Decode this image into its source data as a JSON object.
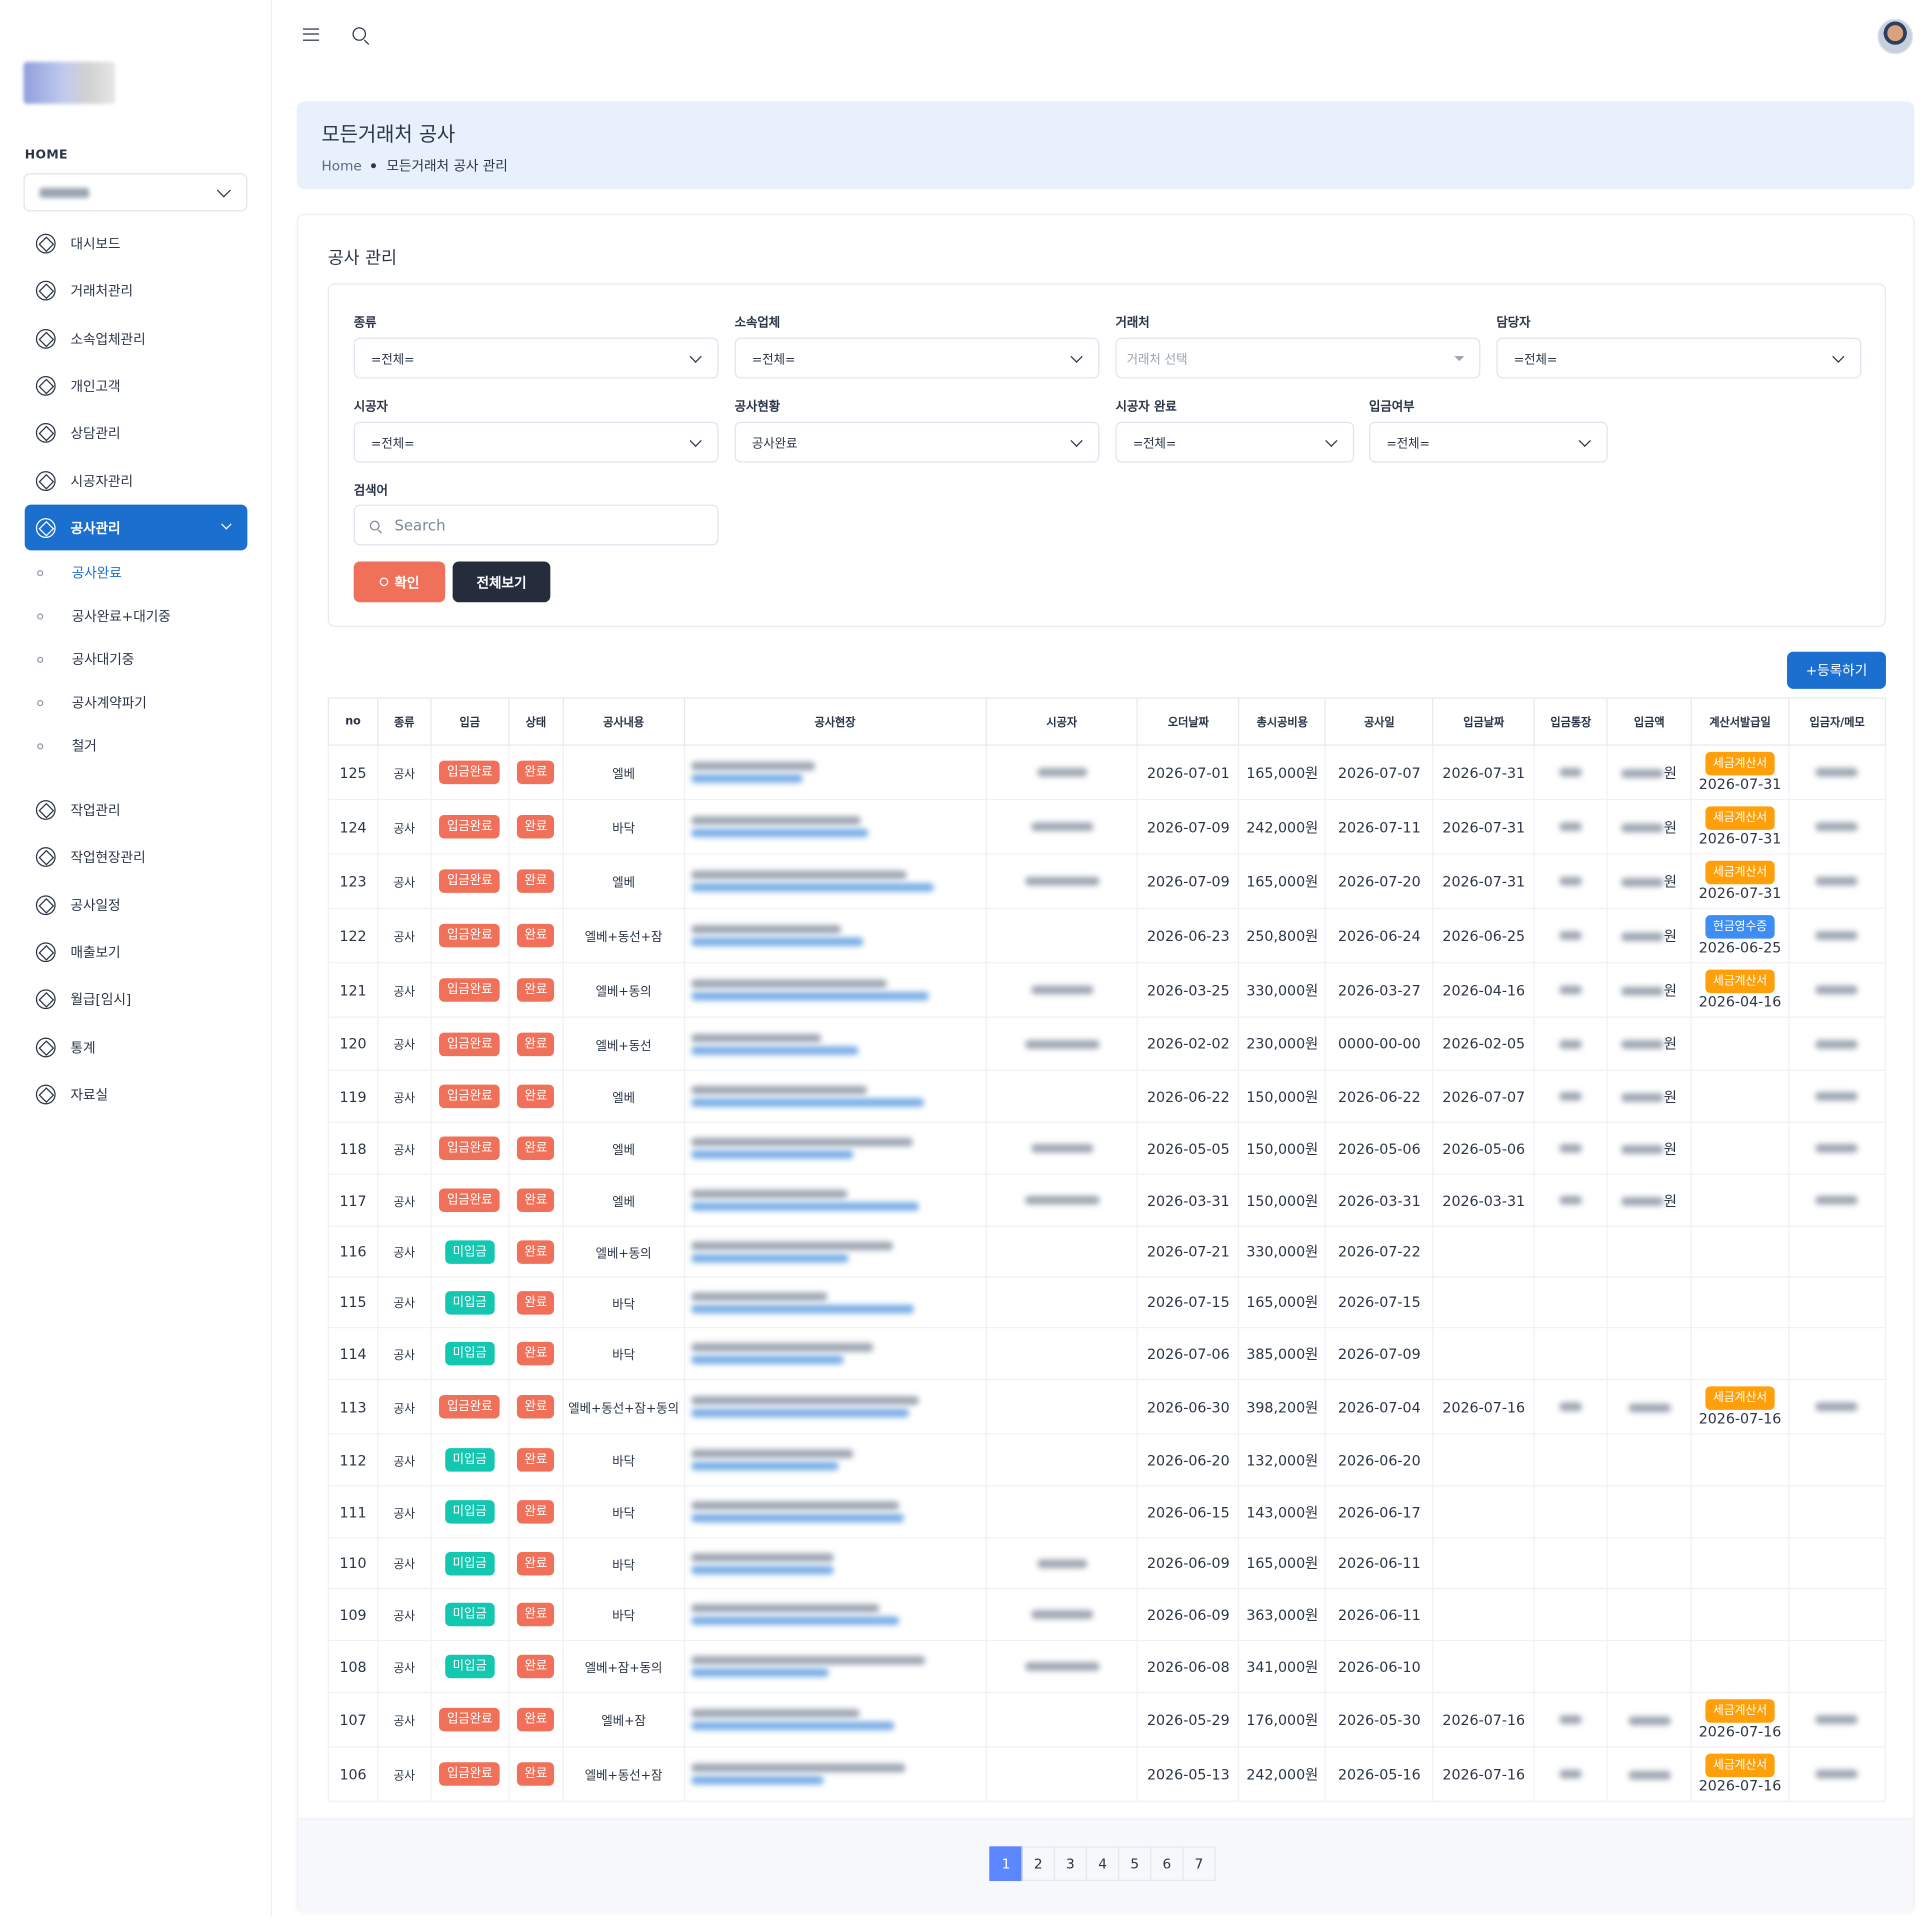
{
  "sidebar": {
    "home_label": "HOME",
    "items": [
      {
        "label": "대시보드",
        "icon": "aperture-icon"
      },
      {
        "label": "거래처관리",
        "icon": "aperture-icon"
      },
      {
        "label": "소속업체관리",
        "icon": "aperture-icon"
      },
      {
        "label": "개인고객",
        "icon": "aperture-icon"
      },
      {
        "label": "상담관리",
        "icon": "aperture-icon"
      },
      {
        "label": "시공자관리",
        "icon": "aperture-icon"
      },
      {
        "label": "공사관리",
        "icon": "aperture-icon"
      },
      {
        "label": "작업관리",
        "icon": "aperture-icon"
      },
      {
        "label": "작업현장관리",
        "icon": "aperture-icon"
      },
      {
        "label": "공사일정",
        "icon": "aperture-icon"
      },
      {
        "label": "매출보기",
        "icon": "aperture-icon"
      },
      {
        "label": "월급[임시]",
        "icon": "aperture-icon"
      },
      {
        "label": "통계",
        "icon": "aperture-icon"
      },
      {
        "label": "자료실",
        "icon": "aperture-icon"
      }
    ],
    "sub_items": [
      "공사완료",
      "공사완료+대기중",
      "공사대기중",
      "공사계약파기",
      "철거"
    ]
  },
  "header": {
    "title": "모든거래처 공사",
    "crumb_home": "Home",
    "crumb_current": "모든거래처 공사 관리"
  },
  "card": {
    "title": "공사 관리"
  },
  "filters": {
    "type": {
      "label": "종류",
      "value": "=전체="
    },
    "company": {
      "label": "소속업체",
      "value": "=전체="
    },
    "client": {
      "label": "거래처",
      "placeholder": "거래처 선택"
    },
    "manager": {
      "label": "담당자",
      "value": "=전체="
    },
    "builder": {
      "label": "시공자",
      "value": "=전체="
    },
    "status": {
      "label": "공사현황",
      "value": "공사완료"
    },
    "builder_done": {
      "label": "시공자 완료",
      "value": "=전체="
    },
    "deposit": {
      "label": "입금여부",
      "value": "=전체="
    },
    "keyword": {
      "label": "검색어",
      "placeholder": "Search"
    },
    "confirm_label": "확인",
    "show_all_label": "전체보기"
  },
  "register_label": "+등록하기",
  "table": {
    "headers": [
      "no",
      "종류",
      "입금",
      "상태",
      "공사내용",
      "공사현장",
      "시공자",
      "오더날짜",
      "총시공비용",
      "공사일",
      "입금날짜",
      "입금통장",
      "입금액",
      "계산서발급일",
      "입금자/메모"
    ],
    "rows": [
      {
        "no": "125",
        "type": "공사",
        "pay": "입금완료",
        "state": "완료",
        "content": "엘베",
        "order": "2026-07-01",
        "cost": "165,000원",
        "work": "2026-07-07",
        "paydate": "2026-07-31",
        "won": "원",
        "inv": "세금계산서",
        "invdate": "2026-07-31",
        "builder": true,
        "memo": true
      },
      {
        "no": "124",
        "type": "공사",
        "pay": "입금완료",
        "state": "완료",
        "content": "바닥",
        "order": "2026-07-09",
        "cost": "242,000원",
        "work": "2026-07-11",
        "paydate": "2026-07-31",
        "won": "원",
        "inv": "세금계산서",
        "invdate": "2026-07-31",
        "builder": true,
        "memo": true
      },
      {
        "no": "123",
        "type": "공사",
        "pay": "입금완료",
        "state": "완료",
        "content": "엘베",
        "order": "2026-07-09",
        "cost": "165,000원",
        "work": "2026-07-20",
        "paydate": "2026-07-31",
        "won": "원",
        "inv": "세금계산서",
        "invdate": "2026-07-31",
        "builder": true,
        "memo": true
      },
      {
        "no": "122",
        "type": "공사",
        "pay": "입금완료",
        "state": "완료",
        "content": "엘베+동선+잠",
        "order": "2026-06-23",
        "cost": "250,800원",
        "work": "2026-06-24",
        "paydate": "2026-06-25",
        "won": "원",
        "inv": "현금영수증",
        "invdate": "2026-06-25",
        "builder": false,
        "memo": true
      },
      {
        "no": "121",
        "type": "공사",
        "pay": "입금완료",
        "state": "완료",
        "content": "엘베+동의",
        "order": "2026-03-25",
        "cost": "330,000원",
        "work": "2026-03-27",
        "paydate": "2026-04-16",
        "won": "원",
        "inv": "세금계산서",
        "invdate": "2026-04-16",
        "builder": true,
        "memo": true
      },
      {
        "no": "120",
        "type": "공사",
        "pay": "입금완료",
        "state": "완료",
        "content": "엘베+동선",
        "order": "2026-02-02",
        "cost": "230,000원",
        "work": "0000-00-00",
        "paydate": "2026-02-05",
        "won": "원",
        "inv": "",
        "invdate": "",
        "builder": true,
        "memo": true
      },
      {
        "no": "119",
        "type": "공사",
        "pay": "입금완료",
        "state": "완료",
        "content": "엘베",
        "order": "2026-06-22",
        "cost": "150,000원",
        "work": "2026-06-22",
        "paydate": "2026-07-07",
        "won": "원",
        "inv": "",
        "invdate": "",
        "builder": false,
        "memo": true
      },
      {
        "no": "118",
        "type": "공사",
        "pay": "입금완료",
        "state": "완료",
        "content": "엘베",
        "order": "2026-05-05",
        "cost": "150,000원",
        "work": "2026-05-06",
        "paydate": "2026-05-06",
        "won": "원",
        "inv": "",
        "invdate": "",
        "builder": true,
        "memo": true
      },
      {
        "no": "117",
        "type": "공사",
        "pay": "입금완료",
        "state": "완료",
        "content": "엘베",
        "order": "2026-03-31",
        "cost": "150,000원",
        "work": "2026-03-31",
        "paydate": "2026-03-31",
        "won": "원",
        "inv": "",
        "invdate": "",
        "builder": true,
        "memo": true
      },
      {
        "no": "116",
        "type": "공사",
        "pay": "미입금",
        "state": "완료",
        "content": "엘베+동의",
        "order": "2026-07-21",
        "cost": "330,000원",
        "work": "2026-07-22",
        "paydate": "",
        "won": "",
        "inv": "",
        "invdate": "",
        "builder": false,
        "memo": false
      },
      {
        "no": "115",
        "type": "공사",
        "pay": "미입금",
        "state": "완료",
        "content": "바닥",
        "order": "2026-07-15",
        "cost": "165,000원",
        "work": "2026-07-15",
        "paydate": "",
        "won": "",
        "inv": "",
        "invdate": "",
        "builder": false,
        "memo": false
      },
      {
        "no": "114",
        "type": "공사",
        "pay": "미입금",
        "state": "완료",
        "content": "바닥",
        "order": "2026-07-06",
        "cost": "385,000원",
        "work": "2026-07-09",
        "paydate": "",
        "won": "",
        "inv": "",
        "invdate": "",
        "builder": false,
        "memo": false
      },
      {
        "no": "113",
        "type": "공사",
        "pay": "입금완료",
        "state": "완료",
        "content": "엘베+동선+잠+동의",
        "order": "2026-06-30",
        "cost": "398,200원",
        "work": "2026-07-04",
        "paydate": "2026-07-16",
        "won": "",
        "inv": "세금계산서",
        "invdate": "2026-07-16",
        "builder": false,
        "memo": true
      },
      {
        "no": "112",
        "type": "공사",
        "pay": "미입금",
        "state": "완료",
        "content": "바닥",
        "order": "2026-06-20",
        "cost": "132,000원",
        "work": "2026-06-20",
        "paydate": "",
        "won": "",
        "inv": "",
        "invdate": "",
        "builder": false,
        "memo": false
      },
      {
        "no": "111",
        "type": "공사",
        "pay": "미입금",
        "state": "완료",
        "content": "바닥",
        "order": "2026-06-15",
        "cost": "143,000원",
        "work": "2026-06-17",
        "paydate": "",
        "won": "",
        "inv": "",
        "invdate": "",
        "builder": false,
        "memo": false
      },
      {
        "no": "110",
        "type": "공사",
        "pay": "미입금",
        "state": "완료",
        "content": "바닥",
        "order": "2026-06-09",
        "cost": "165,000원",
        "work": "2026-06-11",
        "paydate": "",
        "won": "",
        "inv": "",
        "invdate": "",
        "builder": true,
        "memo": false
      },
      {
        "no": "109",
        "type": "공사",
        "pay": "미입금",
        "state": "완료",
        "content": "바닥",
        "order": "2026-06-09",
        "cost": "363,000원",
        "work": "2026-06-11",
        "paydate": "",
        "won": "",
        "inv": "",
        "invdate": "",
        "builder": true,
        "memo": false
      },
      {
        "no": "108",
        "type": "공사",
        "pay": "미입금",
        "state": "완료",
        "content": "엘베+잠+동의",
        "order": "2026-06-08",
        "cost": "341,000원",
        "work": "2026-06-10",
        "paydate": "",
        "won": "",
        "inv": "",
        "invdate": "",
        "builder": true,
        "memo": false
      },
      {
        "no": "107",
        "type": "공사",
        "pay": "입금완료",
        "state": "완료",
        "content": "엘베+잠",
        "order": "2026-05-29",
        "cost": "176,000원",
        "work": "2026-05-30",
        "paydate": "2026-07-16",
        "won": "",
        "inv": "세금계산서",
        "invdate": "2026-07-16",
        "builder": false,
        "memo": true
      },
      {
        "no": "106",
        "type": "공사",
        "pay": "입금완료",
        "state": "완료",
        "content": "엘베+동선+잠",
        "order": "2026-05-13",
        "cost": "242,000원",
        "work": "2026-05-16",
        "paydate": "2026-07-16",
        "won": "",
        "inv": "세금계산서",
        "invdate": "2026-07-16",
        "builder": false,
        "memo": true
      }
    ]
  },
  "pagination": {
    "pages": [
      "1",
      "2",
      "3",
      "4",
      "5",
      "6",
      "7"
    ],
    "current": "1"
  },
  "colors": {
    "primary": "#1a6fcf",
    "paid": "#f0705a",
    "unpaid": "#13c7b0",
    "tax_invoice": "#ff9f0a",
    "cash_receipt": "#3d8df5",
    "header_bg": "#e8f0fc"
  }
}
